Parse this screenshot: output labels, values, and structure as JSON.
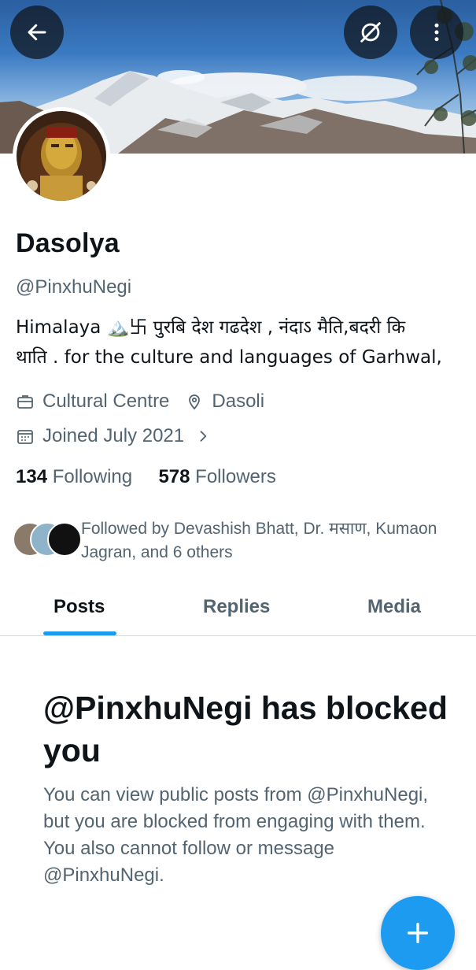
{
  "header": {
    "back_icon": "arrow-left-icon",
    "privacy_icon": "eye-slash-icon",
    "more_icon": "more-vertical-icon"
  },
  "profile": {
    "name": "Dasolya",
    "handle": "@PinxhuNegi",
    "bio_line1": "Himalaya 🏔️卐 पुरबि देश गढदेश , नंदाऽ मैति,बदरी कि",
    "bio_line2": "थाति .   for the culture and languages  of Garhwal,",
    "category": "Cultural Centre",
    "location": "Dasoli",
    "joined": "Joined July 2021",
    "following_count": "134",
    "following_label": "Following",
    "followers_count": "578",
    "followers_label": "Followers",
    "followed_by": "Followed by Devashish Bhatt, Dr. मसाण, Kumaon Jagran, and 6 others"
  },
  "tabs": [
    {
      "label": "Posts",
      "active": true
    },
    {
      "label": "Replies",
      "active": false
    },
    {
      "label": "Media",
      "active": false
    }
  ],
  "blocked": {
    "title": "@PinxhuNegi has blocked you",
    "description": "You can view public posts from @PinxhuNegi, but you are blocked from engaging with them. You also cannot follow or message @PinxhuNegi."
  },
  "fab": {
    "icon": "plus-icon"
  },
  "colors": {
    "accent": "#1d9bf0",
    "text_primary": "#0f1419",
    "text_secondary": "#536471"
  }
}
